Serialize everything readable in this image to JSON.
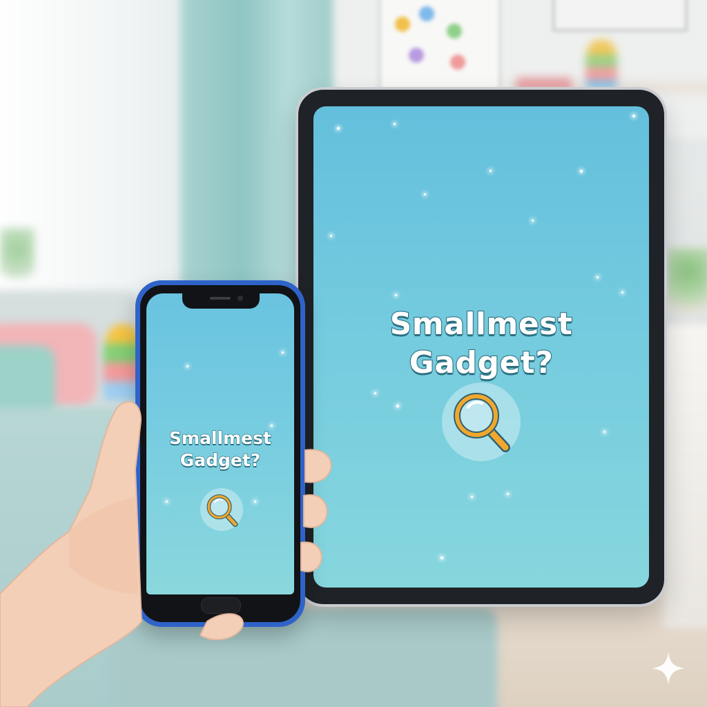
{
  "tablet": {
    "title_line1": "Smallmest",
    "title_line2": "Gadget?",
    "icon": "magnifying-glass-icon"
  },
  "phone": {
    "title_line1": "Smallmest",
    "title_line2": "Gadget?",
    "icon": "magnifying-glass-icon"
  },
  "colors": {
    "screen_top": "#63bfdc",
    "screen_bottom": "#86d6dd",
    "title_outline": "#2b6f7f",
    "magnifier_rim": "#f0a72e",
    "phone_case": "#2f63c9"
  },
  "watermark_icon": "sparkle-icon"
}
